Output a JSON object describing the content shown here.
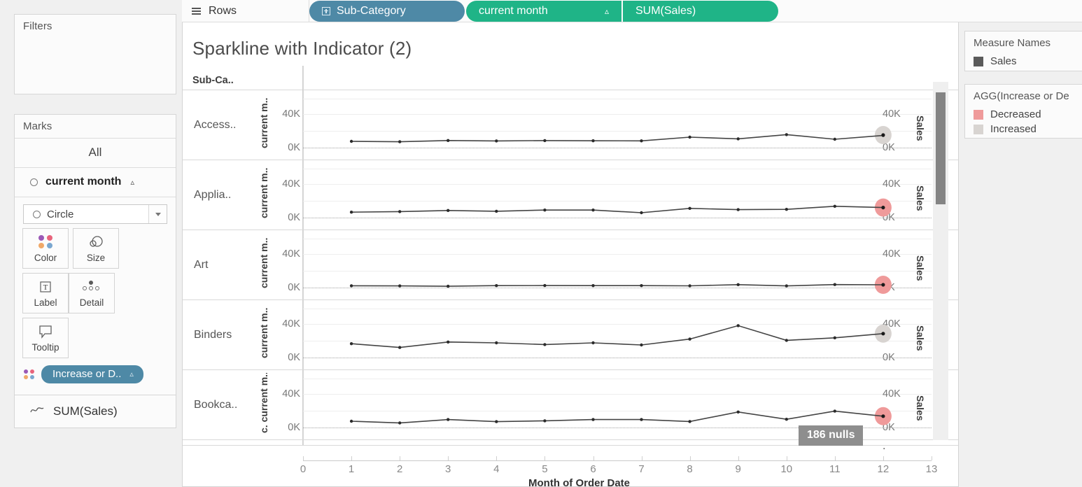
{
  "rows_shelf": {
    "label": "Rows",
    "icon": "rows-hamburger-icon",
    "pills": [
      {
        "text": "Sub-Category",
        "color": "#4e89a6",
        "kind": "dimension",
        "has_plus": true,
        "has_sort": false
      },
      {
        "text": "current month",
        "color": "#1fb487",
        "kind": "measure",
        "has_plus": false,
        "has_sort": true,
        "sort_glyph": "▵"
      },
      {
        "text": "SUM(Sales)",
        "color": "#1fb487",
        "kind": "measure",
        "has_plus": false,
        "has_sort": false
      }
    ]
  },
  "filters": {
    "title": "Filters",
    "items": []
  },
  "marks": {
    "title": "Marks",
    "all_label": "All",
    "card_label": "current month",
    "card_sort_glyph": "▵",
    "mark_type": "Circle",
    "buttons": [
      {
        "label": "Color",
        "icon": "color-dots-icon"
      },
      {
        "label": "Size",
        "icon": "size-circles-icon"
      },
      {
        "label": "Label",
        "icon": "label-text-icon"
      },
      {
        "label": "Detail",
        "icon": "detail-dots-icon"
      },
      {
        "label": "Tooltip",
        "icon": "tooltip-bubble-icon"
      }
    ],
    "color_pill": {
      "text": "Increase or D..",
      "sort_glyph": "▵",
      "color": "#4e89a6"
    },
    "second_card": {
      "label": "SUM(Sales)",
      "icon": "line-mark-icon"
    }
  },
  "viz": {
    "title": "Sparkline with Indicator (2)",
    "row_header": "Sub-Ca..",
    "tooltip": "186 nulls",
    "left_axis_title": "current m..",
    "left_axis_title_last": "c. current m..",
    "right_axis_title": "Sales",
    "x_axis_title": "Month of Order Date",
    "x_ticks": [
      "0",
      "1",
      "2",
      "3",
      "4",
      "5",
      "6",
      "7",
      "8",
      "9",
      "10",
      "11",
      "12",
      "13"
    ],
    "y_ticks": [
      "40K",
      "0K"
    ]
  },
  "legend": {
    "measure_names": {
      "title": "Measure Names",
      "items": [
        {
          "label": "Sales",
          "color": "#5a5a5a"
        }
      ]
    },
    "increase_decrease": {
      "title": "AGG(Increase or De",
      "items": [
        {
          "label": "Decreased",
          "color": "#ef9a9a"
        },
        {
          "label": "Increased",
          "color": "#d8d4d1"
        }
      ]
    }
  },
  "chart_data": {
    "type": "line",
    "title": "Sparkline with Indicator (2)",
    "xlabel": "Month of Order Date",
    "ylabel": "Sales",
    "x": [
      1,
      2,
      3,
      4,
      5,
      6,
      7,
      8,
      9,
      10,
      11,
      12
    ],
    "xlim": [
      0,
      13
    ],
    "ylim": [
      0,
      60000
    ],
    "yticks": [
      0,
      40000
    ],
    "ytick_labels": [
      "0K",
      "40K"
    ],
    "grid": true,
    "legend_position": "right",
    "panels": [
      {
        "name": "Accessories",
        "row_label": "Access..",
        "values": [
          7500,
          7000,
          8500,
          8000,
          8400,
          8200,
          8100,
          12500,
          10500,
          15500,
          10000,
          14500,
          15000
        ],
        "end_marker": {
          "x": 12,
          "value": 15000,
          "status": "Increased",
          "color": "#d8d4d1"
        }
      },
      {
        "name": "Appliances",
        "row_label": "Applia..",
        "values": [
          6500,
          7200,
          8500,
          7600,
          9000,
          9000,
          5800,
          11000,
          9500,
          9800,
          13500,
          12000
        ],
        "end_marker": {
          "x": 12,
          "value": 12000,
          "status": "Decreased",
          "color": "#ef9a9a"
        }
      },
      {
        "name": "Art",
        "row_label": "Art",
        "values": [
          2200,
          2000,
          1600,
          2300,
          2400,
          2300,
          2300,
          2100,
          3500,
          2000,
          3600,
          3300
        ],
        "end_marker": {
          "x": 12,
          "value": 3300,
          "status": "Decreased",
          "color": "#ef9a9a"
        }
      },
      {
        "name": "Binders",
        "row_label": "Binders",
        "values": [
          16500,
          12000,
          18500,
          17500,
          15500,
          17500,
          15000,
          22000,
          38000,
          20500,
          23500,
          28500
        ],
        "end_marker": {
          "x": 12,
          "value": 28500,
          "status": "Increased",
          "color": "#d8d4d1"
        }
      },
      {
        "name": "Bookcases",
        "row_label": "Bookca..",
        "values": [
          7500,
          5500,
          9500,
          7000,
          8000,
          9500,
          9500,
          7200,
          18500,
          9800,
          19500,
          13500
        ],
        "end_marker": {
          "x": 12,
          "value": 13500,
          "status": "Decreased",
          "color": "#ef9a9a"
        }
      }
    ]
  }
}
